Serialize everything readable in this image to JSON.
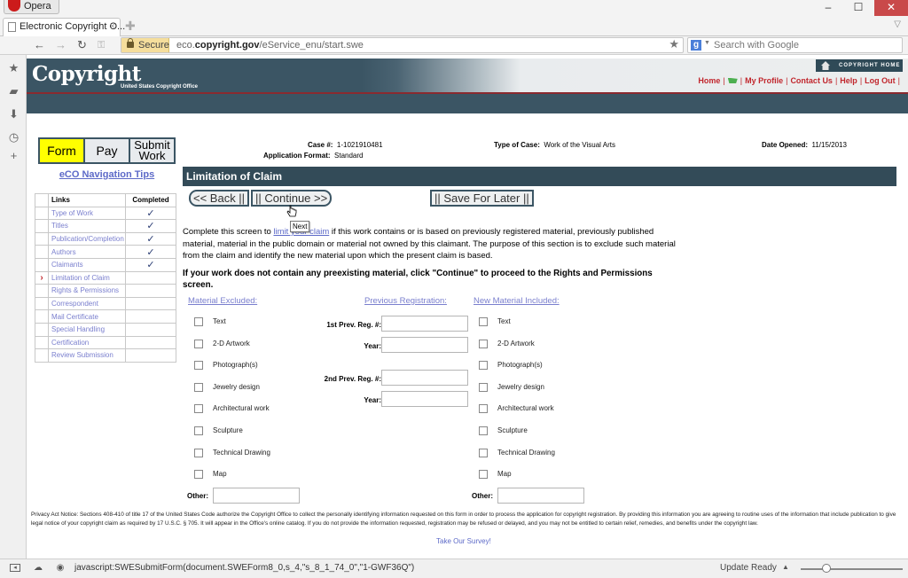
{
  "browser": {
    "app_name": "Opera",
    "tab_title": "Electronic Copyright O...",
    "secure_label": "Secure",
    "url_prefix": "eco.",
    "url_domain": "copyright.gov",
    "url_path": "/eService_enu/start.swe",
    "search_placeholder": "Search with Google",
    "status_url": "javascript:SWESubmitForm(document.SWEForm8_0,s_4,\"s_8_1_74_0\",\"1-GWF36Q\")",
    "update_label": "Update Ready",
    "zoom_level_fraction": 0.25
  },
  "header": {
    "logo_text": "Copyright",
    "logo_subtitle": "United States Copyright Office",
    "copyright_home": "COPYRIGHT HOME",
    "links": [
      "Home",
      "My Profile",
      "Contact Us",
      "Help",
      "Log Out"
    ]
  },
  "steps": [
    {
      "label": "Form",
      "active": true
    },
    {
      "label": "Pay",
      "active": false
    },
    {
      "label": "Submit Work",
      "active": false
    }
  ],
  "nav_tips": "eCO Navigation Tips",
  "links_table": {
    "headers": [
      "Links",
      "Completed"
    ],
    "rows": [
      {
        "label": "Type of Work",
        "completed": "✓",
        "current": ""
      },
      {
        "label": "Titles",
        "completed": "✓",
        "current": ""
      },
      {
        "label": "Publication/Completion",
        "completed": "✓",
        "current": ""
      },
      {
        "label": "Authors",
        "completed": "✓",
        "current": ""
      },
      {
        "label": "Claimants",
        "completed": "✓",
        "current": ""
      },
      {
        "label": "Limitation of Claim",
        "completed": "",
        "current": "›"
      },
      {
        "label": "Rights & Permissions",
        "completed": "",
        "current": ""
      },
      {
        "label": "Correspondent",
        "completed": "",
        "current": ""
      },
      {
        "label": "Mail Certificate",
        "completed": "",
        "current": ""
      },
      {
        "label": "Special Handling",
        "completed": "",
        "current": ""
      },
      {
        "label": "Certification",
        "completed": "",
        "current": ""
      },
      {
        "label": "Review Submission",
        "completed": "",
        "current": ""
      }
    ]
  },
  "case": {
    "case_label": "Case #:",
    "case_value": "1-1021910481",
    "format_label": "Application Format:",
    "format_value": "Standard",
    "type_label": "Type of Case:",
    "type_value": "Work of the Visual Arts",
    "date_label": "Date Opened:",
    "date_value": "11/15/2013"
  },
  "section_title": "Limitation of Claim",
  "buttons": {
    "back": "<< Back ||",
    "continue": "|| Continue >>",
    "save": "|| Save For Later ||"
  },
  "tooltip": "Next",
  "intro": {
    "before": "Complete this screen to ",
    "link": "limit your claim",
    "after": " if this work contains or is based on previously registered material, previously published material, material in the public domain or material not owned by this claimant. The purpose of this section is to exclude such material from the claim and identify the new material upon which the present claim is based."
  },
  "bold_note": "If your work does not contain any preexisting material, click \"Continue\" to proceed to the Rights and Permissions screen.",
  "columns": {
    "excluded": "Material Excluded:",
    "previous": "Previous Registration:",
    "new": "New Material Included:"
  },
  "material_options": [
    "Text",
    "2-D Artwork",
    "Photograph(s)",
    "Jewelry design",
    "Architectural work",
    "Sculpture",
    "Technical Drawing",
    "Map"
  ],
  "other_label": "Other:",
  "prev_reg": {
    "first_reg": "1st Prev. Reg. #:",
    "first_year": "Year:",
    "second_reg": "2nd Prev. Reg. #:",
    "second_year": "Year:"
  },
  "privacy_notice": "Privacy Act Notice: Sections 408-410 of title 17 of the United States Code authorize the Copyright Office to collect the personally identifying information requested on this form in order to process the application for copyright registration. By providing this information you are agreeing to routine uses of the information that include publication to give legal notice of your copyright claim as required by 17 U.S.C. § 705. It will appear in the Office's online catalog. If you do not provide the information requested, registration may be refused or delayed, and you may not be entitled to certain relief, remedies, and benefits under the copyright law.",
  "survey_link": "Take Our Survey!"
}
